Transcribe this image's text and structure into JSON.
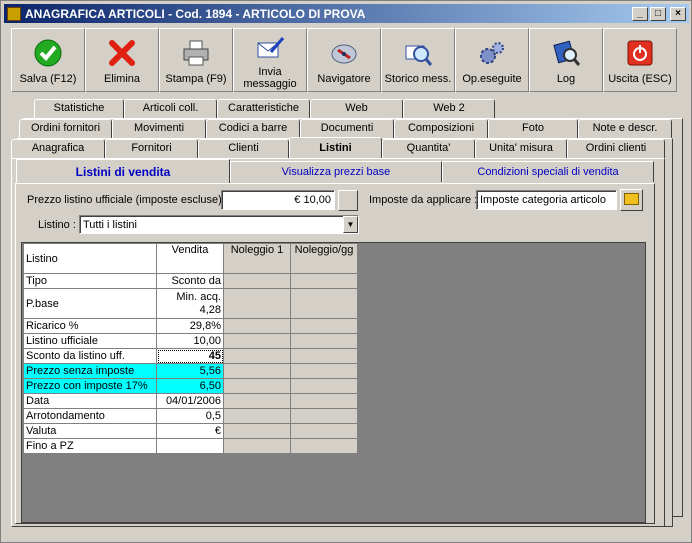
{
  "window": {
    "title": "ANAGRAFICA ARTICOLI - Cod. 1894 - ARTICOLO DI PROVA",
    "min": "_",
    "max": "□",
    "close": "×"
  },
  "toolbar": [
    {
      "label": "Salva (F12)",
      "icon": "check-icon"
    },
    {
      "label": "Elimina",
      "icon": "delete-x-icon"
    },
    {
      "label": "Stampa (F9)",
      "icon": "printer-icon"
    },
    {
      "label": "Invia messaggio",
      "icon": "message-pen-icon"
    },
    {
      "label": "Navigatore",
      "icon": "compass-icon"
    },
    {
      "label": "Storico mess.",
      "icon": "search-message-icon"
    },
    {
      "label": "Op.eseguite",
      "icon": "gears-icon"
    },
    {
      "label": "Log",
      "icon": "log-search-icon"
    },
    {
      "label": "Uscita (ESC)",
      "icon": "power-icon"
    }
  ],
  "tabs": {
    "row1": [
      "Statistiche",
      "Articoli coll.",
      "Caratteristiche",
      "Web",
      "Web 2"
    ],
    "row2": [
      "Ordini fornitori",
      "Movimenti",
      "Codici a barre",
      "Documenti",
      "Composizioni",
      "Foto",
      "Note e descr."
    ],
    "row3": [
      "Anagrafica",
      "Fornitori",
      "Clienti",
      "Listini",
      "Quantita'",
      "Unita' misura",
      "Ordini clienti"
    ]
  },
  "subtabs": [
    "Listini di vendita",
    "Visualizza prezzi base",
    "Condizioni speciali di vendita"
  ],
  "form": {
    "prezzo_label": "Prezzo listino ufficiale (imposte escluse) :",
    "prezzo_value": "€ 10,00",
    "imposte_label": "Imposte da applicare :",
    "imposte_value": "Imposte categoria articolo",
    "listino_label": "Listino :",
    "listino_value": "Tutti i listini"
  },
  "grid": {
    "headers": [
      "Listino",
      "Vendita",
      "Noleggio 1",
      "Noleggio/gg"
    ],
    "rows": [
      {
        "label": "Tipo",
        "value": "Sconto da"
      },
      {
        "label": "P.base",
        "value": "Min. acq.",
        "value2": "4,28"
      },
      {
        "label": "Ricarico %",
        "value": "29,8%"
      },
      {
        "label": "Listino ufficiale",
        "value": "10,00"
      },
      {
        "label": "Sconto da listino uff.",
        "value": "45"
      },
      {
        "label": "Prezzo senza imposte",
        "value": "5,56"
      },
      {
        "label": "Prezzo con imposte 17%",
        "value": "6,50"
      },
      {
        "label": "Data",
        "value": "04/01/2006"
      },
      {
        "label": "Arrotondamento",
        "value": "0,5"
      },
      {
        "label": "Valuta",
        "value": "€"
      },
      {
        "label": "Fino a PZ",
        "value": ""
      }
    ]
  },
  "colors": {
    "highlight": "#00ffff",
    "title_start": "#0a246a",
    "subtab_text": "#0000c0"
  }
}
